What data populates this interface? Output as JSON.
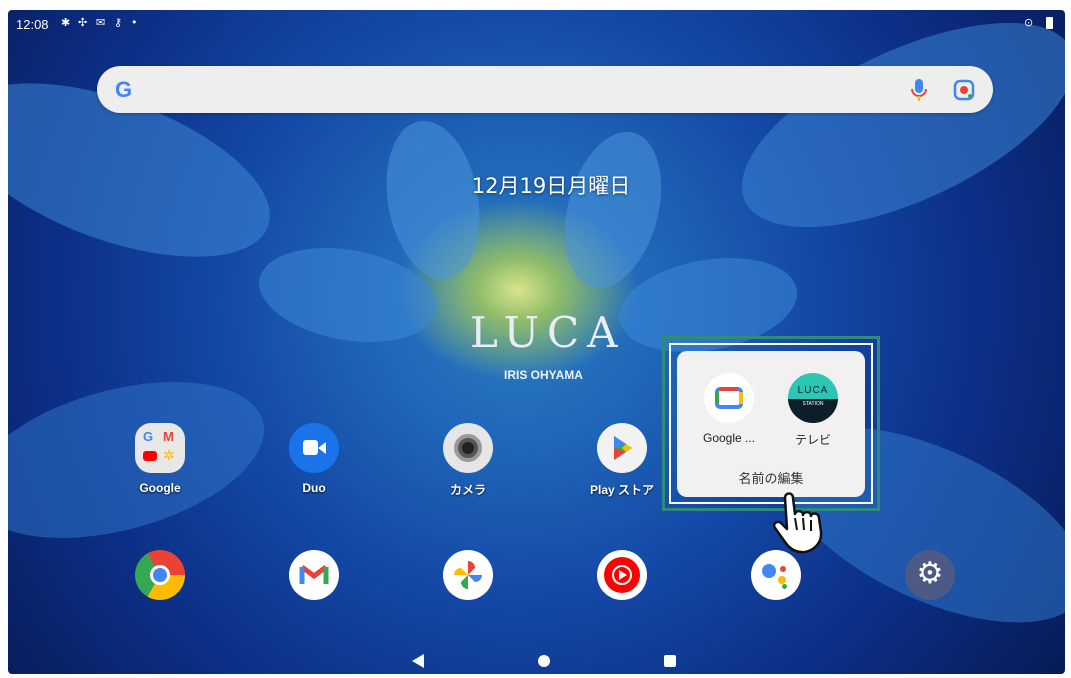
{
  "status_bar": {
    "time": "12:08",
    "left_icons": [
      "gear-icon",
      "usb-debug-icon",
      "gmail-icon",
      "key-icon",
      "dot-icon"
    ],
    "right_icons": [
      "location-icon",
      "battery-icon"
    ]
  },
  "search": {
    "logo": "G",
    "icons": [
      "mic-icon",
      "lens-icon"
    ]
  },
  "date": "12月19日月曜日",
  "wallpaper": {
    "brand": "LUCA",
    "sub": "IRIS OHYAMA"
  },
  "apps_row": [
    {
      "name": "google-folder",
      "label": "Google"
    },
    {
      "name": "duo",
      "label": "Duo"
    },
    {
      "name": "camera",
      "label": "カメラ"
    },
    {
      "name": "play-store",
      "label": "Play ストア"
    }
  ],
  "dock": [
    "chrome",
    "gmail",
    "photos",
    "youtube-music",
    "assistant",
    "settings"
  ],
  "folder": {
    "items": [
      {
        "label": "Google ..."
      },
      {
        "label": "テレビ",
        "badge_top": "LUCA",
        "badge_bottom": "STATION"
      }
    ],
    "name": "名前の編集"
  },
  "colors": {
    "highlight": "#2f8c7d",
    "popup": "#f1f1f1"
  }
}
